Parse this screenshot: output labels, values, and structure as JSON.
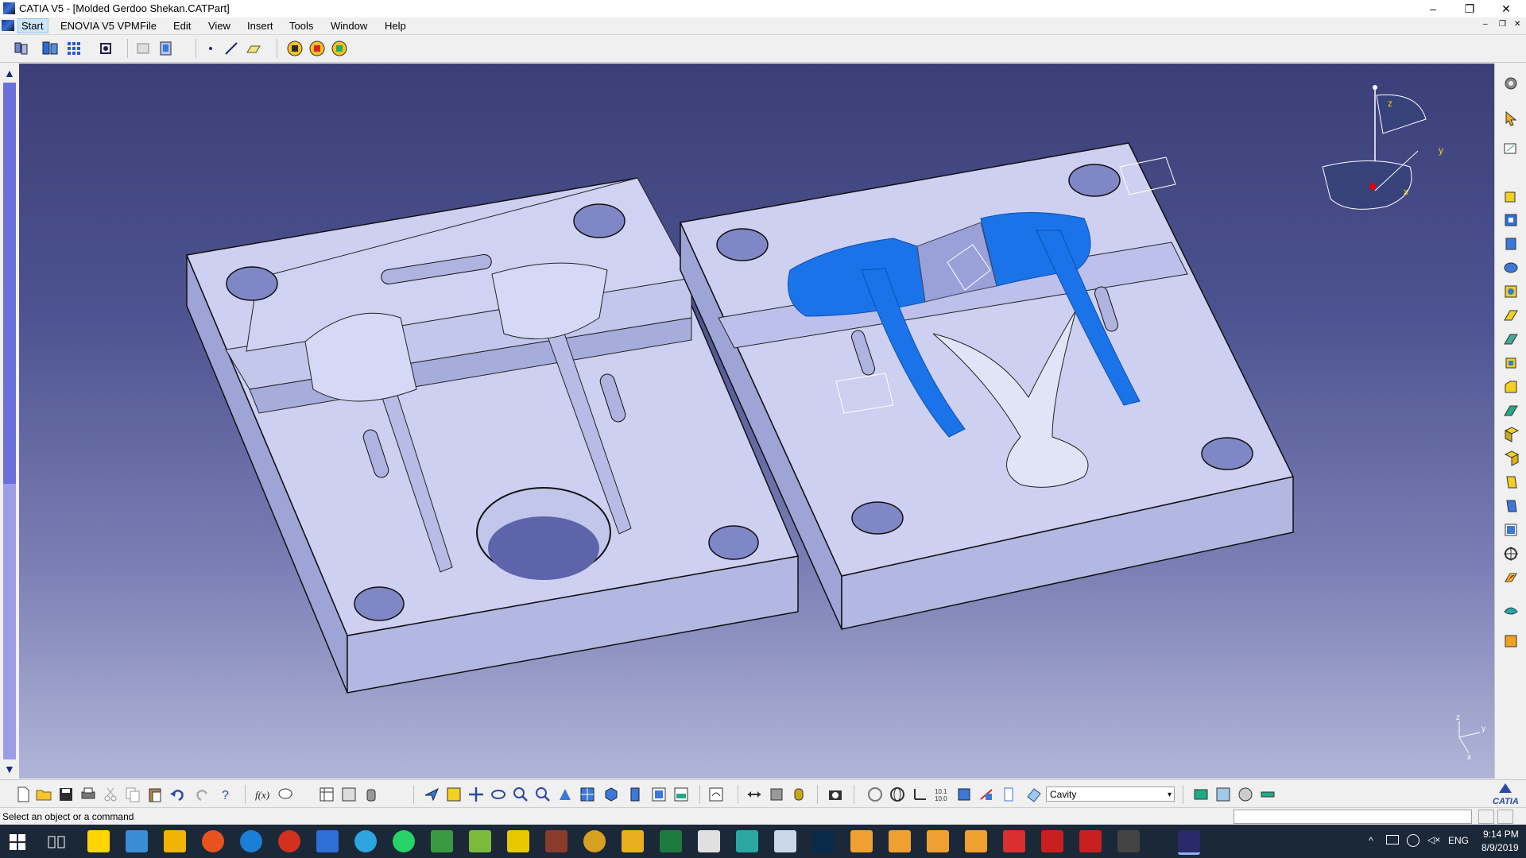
{
  "window": {
    "title": "CATIA V5 - [Molded Gerdoo Shekan.CATPart]",
    "minimize": "–",
    "maximize": "❐",
    "close": "✕"
  },
  "menu": {
    "items": [
      "Start",
      "ENOVIA V5 VPM",
      "File",
      "Edit",
      "View",
      "Insert",
      "Tools",
      "Window",
      "Help"
    ]
  },
  "axis": {
    "z": "z",
    "y": "y",
    "x": "x"
  },
  "bottom_toolbar": {
    "combo_value": "Cavity",
    "combo_arrow": "▾"
  },
  "status": {
    "message": "Select an object or a command"
  },
  "catia_logo": "CATIA",
  "taskbar": {
    "language": "ENG",
    "time": "9:14 PM",
    "date": "8/9/2019",
    "tray_up": "^"
  },
  "colors": {
    "viewport_top": "#3b3f78",
    "viewport_bottom": "#b2b5d8",
    "mold_face": "#cdd0ef",
    "mold_side": "#aab0dd",
    "part_blue": "#1a73e8"
  },
  "icons": {
    "start": "windows-start-icon",
    "task_view": "task-view-icon"
  }
}
